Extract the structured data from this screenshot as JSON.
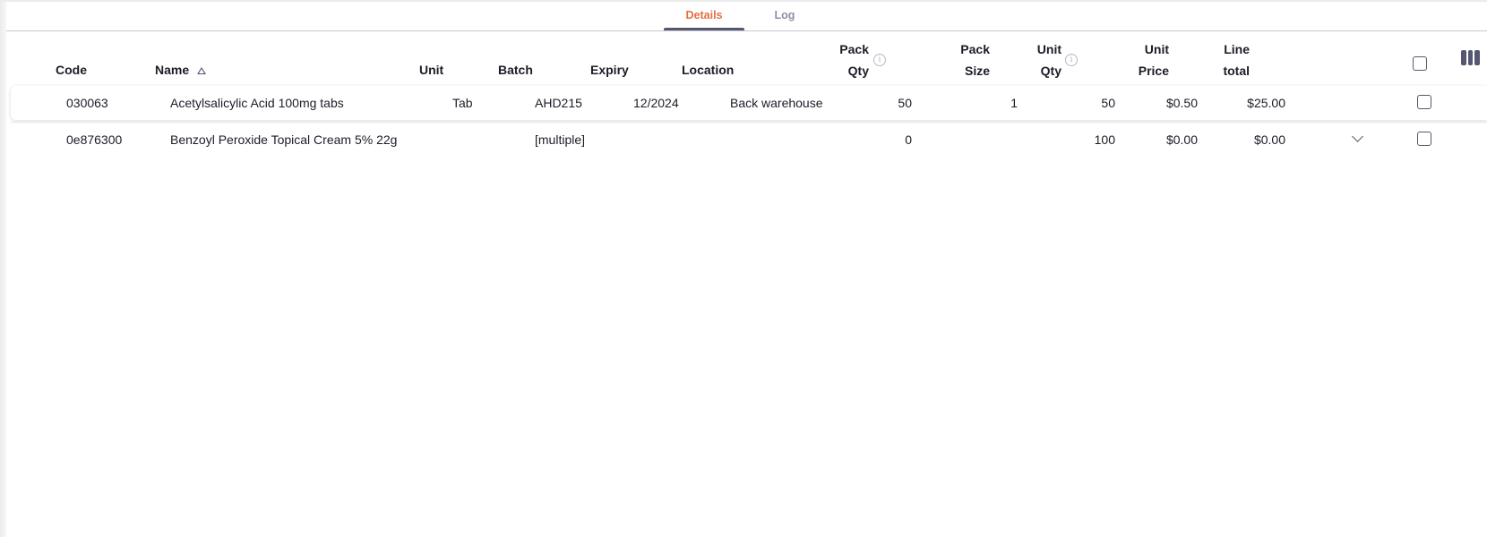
{
  "tabs": [
    {
      "label": "Details",
      "active": true
    },
    {
      "label": "Log",
      "active": false
    }
  ],
  "columns": {
    "code": "Code",
    "name": "Name",
    "unit": "Unit",
    "batch": "Batch",
    "expiry": "Expiry",
    "location": "Location",
    "pack_qty": [
      "Pack",
      "Qty"
    ],
    "pack_size": [
      "Pack",
      "Size"
    ],
    "unit_qty": [
      "Unit",
      "Qty"
    ],
    "unit_price": [
      "Unit",
      "Price"
    ],
    "line_total": [
      "Line",
      "total"
    ]
  },
  "sort": {
    "column": "name",
    "direction": "ascending"
  },
  "rows": [
    {
      "code": "030063",
      "name": "Acetylsalicylic Acid 100mg tabs",
      "unit": "Tab",
      "batch": "AHD215",
      "expiry": "12/2024",
      "location": "Back warehouse",
      "pack_qty": "50",
      "pack_size": "1",
      "unit_qty": "50",
      "unit_price": "$0.50",
      "line_total": "$25.00",
      "expandable": false,
      "checked": false
    },
    {
      "code": "0e876300",
      "name": "Benzoyl Peroxide Topical Cream 5% 22g",
      "unit": "",
      "batch": "[multiple]",
      "expiry": "",
      "location": "",
      "pack_qty": "0",
      "pack_size": "",
      "unit_qty": "100",
      "unit_price": "$0.00",
      "line_total": "$0.00",
      "expandable": true,
      "checked": false
    }
  ],
  "icons": {
    "info": "info-icon",
    "sort": "sort-ascending-icon",
    "columns": "column-manager-icon",
    "expand": "chevron-down-icon"
  },
  "colors": {
    "accent": "#e46f43",
    "tab_underline": "#555770",
    "text": "#1c1c28",
    "muted": "#8f90a6"
  }
}
